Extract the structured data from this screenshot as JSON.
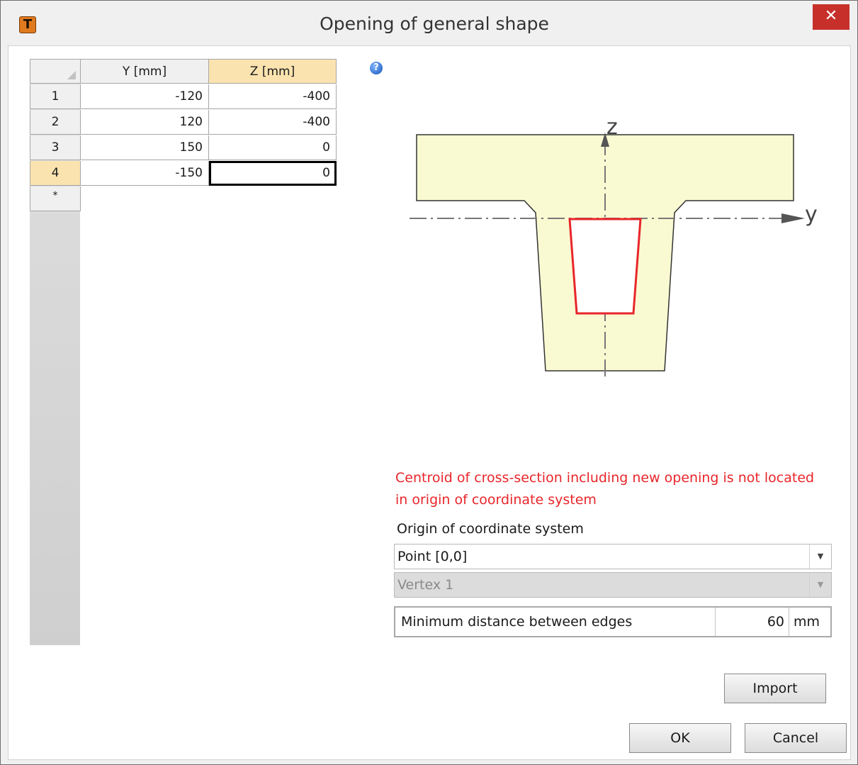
{
  "window": {
    "title": "Opening of general shape",
    "app_icon_letter": "T",
    "close_glyph": "✕",
    "accent_close": "#c7302a"
  },
  "grid": {
    "columns": [
      "Y [mm]",
      "Z [mm]"
    ],
    "corner_glyph": "",
    "help_glyph": "?",
    "rows": [
      {
        "index": "1",
        "y": "-120",
        "z": "-400"
      },
      {
        "index": "2",
        "y": "120",
        "z": "-400"
      },
      {
        "index": "3",
        "y": "150",
        "z": "0"
      },
      {
        "index": "4",
        "y": "-150",
        "z": "0"
      }
    ],
    "new_row_marker": "*",
    "selected_row": "4",
    "selected_column": "Z [mm]"
  },
  "diagram": {
    "axis_z_label": "z",
    "axis_y_label": "y",
    "section_fill": "#fafad2",
    "opening_color": "#e8262a"
  },
  "warning_text_line1": "Centroid of cross-section including new opening is not located",
  "warning_text_line2": "in origin of coordinate system",
  "origin": {
    "label": "Origin of coordinate system",
    "selected": "Point [0,0]",
    "vertex_selected": "Vertex 1"
  },
  "min_distance": {
    "label": "Minimum distance between edges",
    "value": "60",
    "unit": "mm"
  },
  "buttons": {
    "import": "Import",
    "ok": "OK",
    "cancel": "Cancel"
  }
}
